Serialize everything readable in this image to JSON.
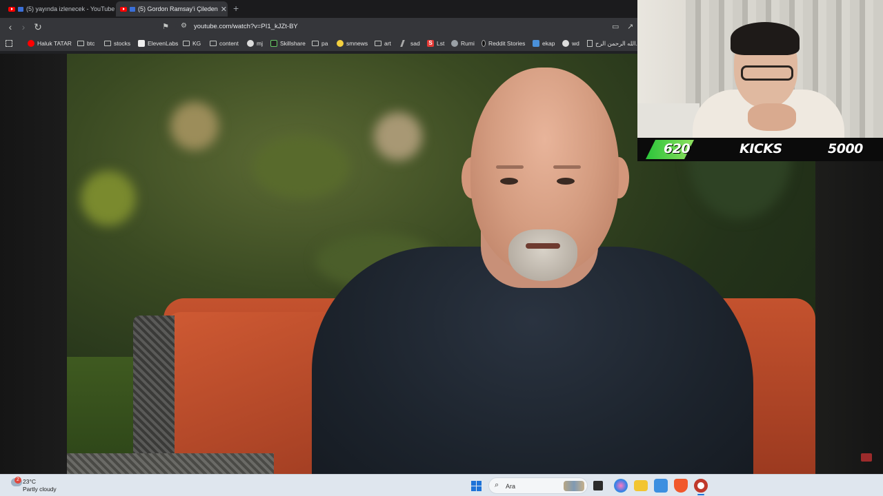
{
  "browser": {
    "tabs": [
      {
        "label": "(5) yayında izlenecek - YouTube",
        "active": false
      },
      {
        "label": "(5) Gordon Ramsay'i Çileden",
        "active": true
      }
    ],
    "address": {
      "url": "youtube.com/watch?v=PI1_kJZt-BY"
    },
    "bookmarks": [
      {
        "label": "Haluk TATAR",
        "icon": "youtube-icon"
      },
      {
        "label": "btc",
        "icon": "folder-icon"
      },
      {
        "label": "stocks",
        "icon": "folder-icon"
      },
      {
        "label": "ElevenLabs",
        "icon": "elevenlabs-icon"
      },
      {
        "label": "KG",
        "icon": "folder-icon"
      },
      {
        "label": "content",
        "icon": "folder-icon"
      },
      {
        "label": "mj",
        "icon": "github-icon"
      },
      {
        "label": "Skillshare",
        "icon": "skillshare-icon"
      },
      {
        "label": "pa",
        "icon": "folder-icon"
      },
      {
        "label": "smnews",
        "icon": "smiley-icon"
      },
      {
        "label": "art",
        "icon": "folder-icon"
      },
      {
        "label": "sad",
        "icon": "slash-icon"
      },
      {
        "label": "Lst",
        "icon": "s-logo-icon"
      },
      {
        "label": "Rumi",
        "icon": "globe-icon"
      },
      {
        "label": "Reddit Stories",
        "icon": "dark-circle-icon"
      },
      {
        "label": "ekap",
        "icon": "bird-icon"
      },
      {
        "label": "wd",
        "icon": "wikipedia-icon"
      },
      {
        "label": "الله الرحمن الرح...",
        "icon": "page-icon"
      }
    ]
  },
  "overlay": {
    "kicks_current": "620",
    "kicks_label": "KICKS",
    "kicks_goal": "5000",
    "kicks_progress": 0.124,
    "bar_color": "#2bc43a"
  },
  "taskbar": {
    "weather_badge": "2",
    "temperature": "23°C",
    "condition": "Partly cloudy",
    "search_placeholder": "Ara"
  }
}
